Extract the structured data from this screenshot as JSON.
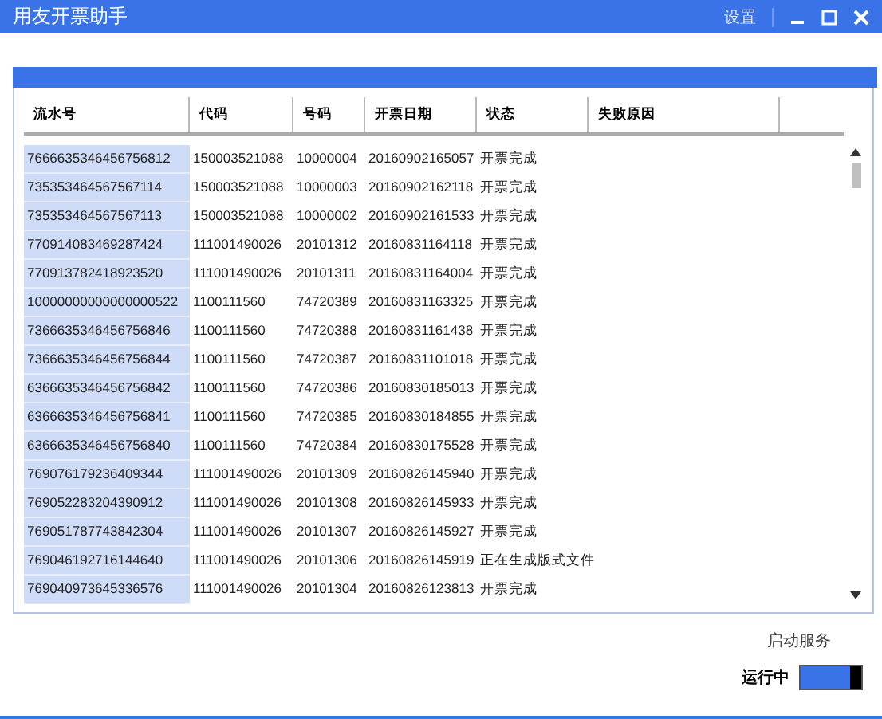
{
  "window": {
    "title": "用友开票助手",
    "settings": "设置"
  },
  "table": {
    "columns": [
      "流水号",
      "代码",
      "号码",
      "开票日期",
      "状态",
      "失败原因"
    ],
    "rows": [
      [
        "7666635346456756812",
        "150003521088",
        "10000004",
        "20160902165057",
        "开票完成"
      ],
      [
        "735353464567567114",
        "150003521088",
        "10000003",
        "20160902162118",
        "开票完成"
      ],
      [
        "735353464567567113",
        "150003521088",
        "10000002",
        "20160902161533",
        "开票完成"
      ],
      [
        "770914083469287424",
        "111001490026",
        "20101312",
        "20160831164118",
        "开票完成"
      ],
      [
        "770913782418923520",
        "111001490026",
        "20101311",
        "20160831164004",
        "开票完成"
      ],
      [
        "10000000000000000522",
        "1100111560",
        "74720389",
        "20160831163325",
        "开票完成"
      ],
      [
        "7366635346456756846",
        "1100111560",
        "74720388",
        "20160831161438",
        "开票完成"
      ],
      [
        "7366635346456756844",
        "1100111560",
        "74720387",
        "20160831101018",
        "开票完成"
      ],
      [
        "6366635346456756842",
        "1100111560",
        "74720386",
        "20160830185013",
        "开票完成"
      ],
      [
        "6366635346456756841",
        "1100111560",
        "74720385",
        "20160830184855",
        "开票完成"
      ],
      [
        "6366635346456756840",
        "1100111560",
        "74720384",
        "20160830175528",
        "开票完成"
      ],
      [
        "769076179236409344",
        "111001490026",
        "20101309",
        "20160826145940",
        "开票完成"
      ],
      [
        "769052283204390912",
        "111001490026",
        "20101308",
        "20160826145933",
        "开票完成"
      ],
      [
        "769051787743842304",
        "111001490026",
        "20101307",
        "20160826145927",
        "开票完成"
      ],
      [
        "769046192716144640",
        "111001490026",
        "20101306",
        "20160826145919",
        "正在生成版式文件"
      ],
      [
        "769040973645336576",
        "111001490026",
        "20101304",
        "20160826123813",
        "开票完成"
      ]
    ]
  },
  "service": {
    "title": "启动服务",
    "status": "运行中",
    "on": true
  }
}
